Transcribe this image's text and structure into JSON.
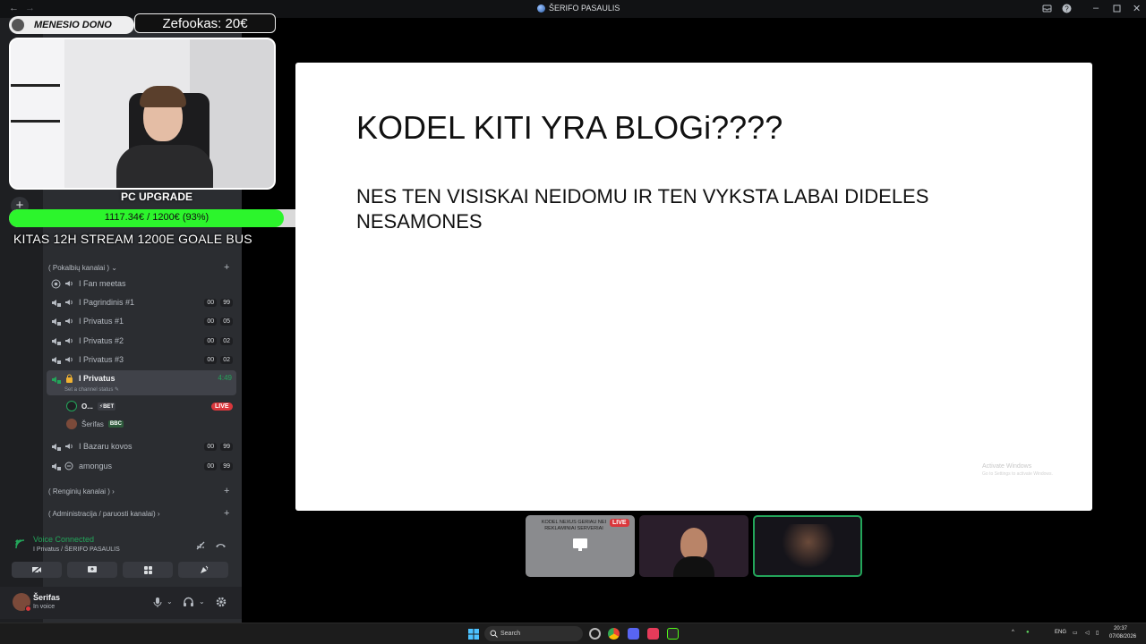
{
  "window": {
    "title": "ŠERIFO PASAULIS",
    "back": "←",
    "forward": "→"
  },
  "overlay": {
    "donor_label": "MENESIO DONO",
    "donor_amount": "Zefookas: 20€",
    "goal_title": "PC UPGRADE",
    "goal_text": "1117.34€ / 1200€ (93%)",
    "goal_progress": 0.93,
    "goal_caption": "KITAS 12H STREAM 1200E GOALE BUS"
  },
  "sidebar": {
    "categories": [
      {
        "label": "( Pokalbių kanalai ) ⌄"
      },
      {
        "label": "( Renginių kanalai ) ›"
      },
      {
        "label": "( Administracija / paruosti kanalai) ›"
      }
    ],
    "channels": [
      {
        "name": "I Fan meetas"
      },
      {
        "name": "I Pagrindinis #1",
        "badges": [
          "00",
          "99"
        ]
      },
      {
        "name": "I Privatus #1",
        "badges": [
          "00",
          "05"
        ]
      },
      {
        "name": "I Privatus #2",
        "badges": [
          "00",
          "02"
        ]
      },
      {
        "name": "I Privatus #3",
        "badges": [
          "00",
          "02"
        ]
      },
      {
        "name": "I Privatus",
        "timer": "4:49",
        "status": "Set a channel status ✎"
      },
      {
        "name": "I Bazaru kovos",
        "badges": [
          "00",
          "99"
        ]
      },
      {
        "name": "amongus",
        "badges": [
          "00",
          "99"
        ]
      }
    ],
    "voice_users": [
      {
        "name": "O...",
        "tag": "⚡BET",
        "live": "LIVE"
      },
      {
        "name": "Šerifas",
        "tag": "BBC"
      }
    ]
  },
  "voice": {
    "status": "Voice Connected",
    "channel": "I Privatus / ŠERIFO PASAULIS"
  },
  "user": {
    "name": "Šerifas",
    "status": "In voice"
  },
  "slide": {
    "title": "KODEL KITI YRA BLOGi????",
    "body": "NES TEN VISISKAI NEIDOMU IR TEN VYKSTA LABAI DIDELES NESAMONES",
    "watermark_1": "Activate Windows",
    "watermark_2": "Go to Settings to activate Windows."
  },
  "tiles": {
    "caption": "KODEL NEXUS GERIAU NEI REKLAMINIAI SERVERIAI",
    "live": "LIVE"
  },
  "taskbar": {
    "search": "Search",
    "lang": "ENG",
    "time": "20:37",
    "date": "07/08/2026"
  },
  "colors": {
    "accent_green": "#23a55a",
    "live_red": "#da373c",
    "goal_green": "#2cf52c"
  }
}
